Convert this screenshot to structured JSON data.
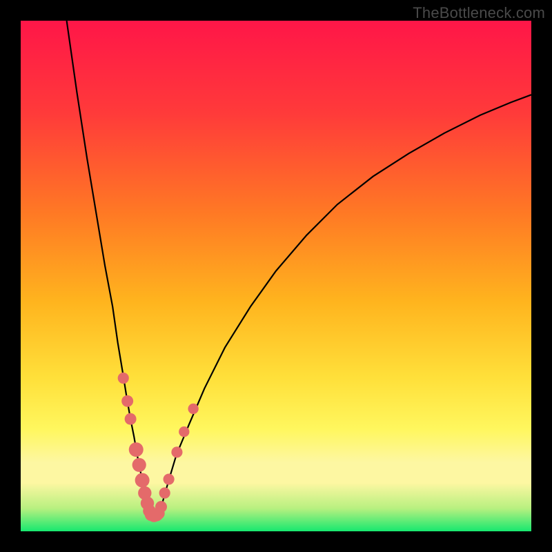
{
  "watermark": "TheBottleneck.com",
  "colors": {
    "top": "#ff1648",
    "mid1": "#ff6a2a",
    "mid2": "#ffc61e",
    "mid3": "#fff04a",
    "band_pale": "#fdf7a2",
    "bottom": "#17e86f",
    "curve": "#000000",
    "dot_fill": "#e46a6a",
    "dot_stroke": "#c24a4a",
    "frame": "#000000"
  },
  "chart_data": {
    "type": "line",
    "title": "",
    "xlabel": "",
    "ylabel": "",
    "xlim": [
      0,
      100
    ],
    "ylim": [
      0,
      100
    ],
    "series": [
      {
        "name": "left-branch",
        "x": [
          9,
          11,
          13,
          15,
          16.5,
          18,
          19,
          20,
          20.8,
          21.5,
          22.2,
          22.8,
          23.4,
          23.9,
          24.4,
          24.9,
          25.3
        ],
        "values": [
          100,
          86,
          73,
          61,
          52,
          44,
          37,
          31,
          26,
          22,
          18.5,
          15,
          12,
          9.5,
          7,
          5,
          3.5
        ]
      },
      {
        "name": "right-branch",
        "x": [
          27.2,
          28,
          29,
          30.5,
          33,
          36,
          40,
          45,
          50,
          56,
          62,
          69,
          76,
          83,
          90,
          96,
          100
        ],
        "values": [
          3.5,
          6.5,
          10,
          15,
          21,
          28,
          36,
          44,
          51,
          58,
          64,
          69.5,
          74,
          78,
          81.5,
          84,
          85.5
        ]
      },
      {
        "name": "flat-bottom",
        "x": [
          25.3,
          25.8,
          26.3,
          26.8,
          27.2
        ],
        "values": [
          3.5,
          3.2,
          3.1,
          3.2,
          3.5
        ]
      }
    ],
    "dots_left_branch": [
      {
        "x": 20.1,
        "y": 30.0,
        "r": 1.0
      },
      {
        "x": 20.9,
        "y": 25.5,
        "r": 1.1
      },
      {
        "x": 21.5,
        "y": 22.0,
        "r": 1.1
      },
      {
        "x": 22.6,
        "y": 16.0,
        "r": 1.6
      },
      {
        "x": 23.2,
        "y": 13.0,
        "r": 1.5
      },
      {
        "x": 23.8,
        "y": 10.0,
        "r": 1.6
      },
      {
        "x": 24.3,
        "y": 7.5,
        "r": 1.4
      },
      {
        "x": 24.8,
        "y": 5.5,
        "r": 1.4
      },
      {
        "x": 25.2,
        "y": 4.0,
        "r": 1.3
      },
      {
        "x": 25.6,
        "y": 3.3,
        "r": 1.4
      },
      {
        "x": 26.1,
        "y": 3.1,
        "r": 1.4
      },
      {
        "x": 26.6,
        "y": 3.2,
        "r": 1.3
      },
      {
        "x": 27.0,
        "y": 3.5,
        "r": 1.2
      }
    ],
    "dots_right_branch": [
      {
        "x": 27.5,
        "y": 4.8,
        "r": 1.1
      },
      {
        "x": 28.2,
        "y": 7.5,
        "r": 1.0
      },
      {
        "x": 29.0,
        "y": 10.2,
        "r": 1.0
      },
      {
        "x": 30.6,
        "y": 15.5,
        "r": 1.0
      },
      {
        "x": 32.0,
        "y": 19.5,
        "r": 0.9
      },
      {
        "x": 33.8,
        "y": 24.0,
        "r": 0.9
      }
    ],
    "gradient_stops": [
      {
        "offset": 0.0,
        "color": "#ff1648"
      },
      {
        "offset": 0.18,
        "color": "#ff3a3a"
      },
      {
        "offset": 0.38,
        "color": "#ff7a24"
      },
      {
        "offset": 0.55,
        "color": "#ffb41e"
      },
      {
        "offset": 0.7,
        "color": "#ffe03a"
      },
      {
        "offset": 0.8,
        "color": "#fff75e"
      },
      {
        "offset": 0.865,
        "color": "#fdf7a2"
      },
      {
        "offset": 0.905,
        "color": "#fdf7a2"
      },
      {
        "offset": 0.955,
        "color": "#b8f080"
      },
      {
        "offset": 1.0,
        "color": "#17e86f"
      }
    ]
  }
}
